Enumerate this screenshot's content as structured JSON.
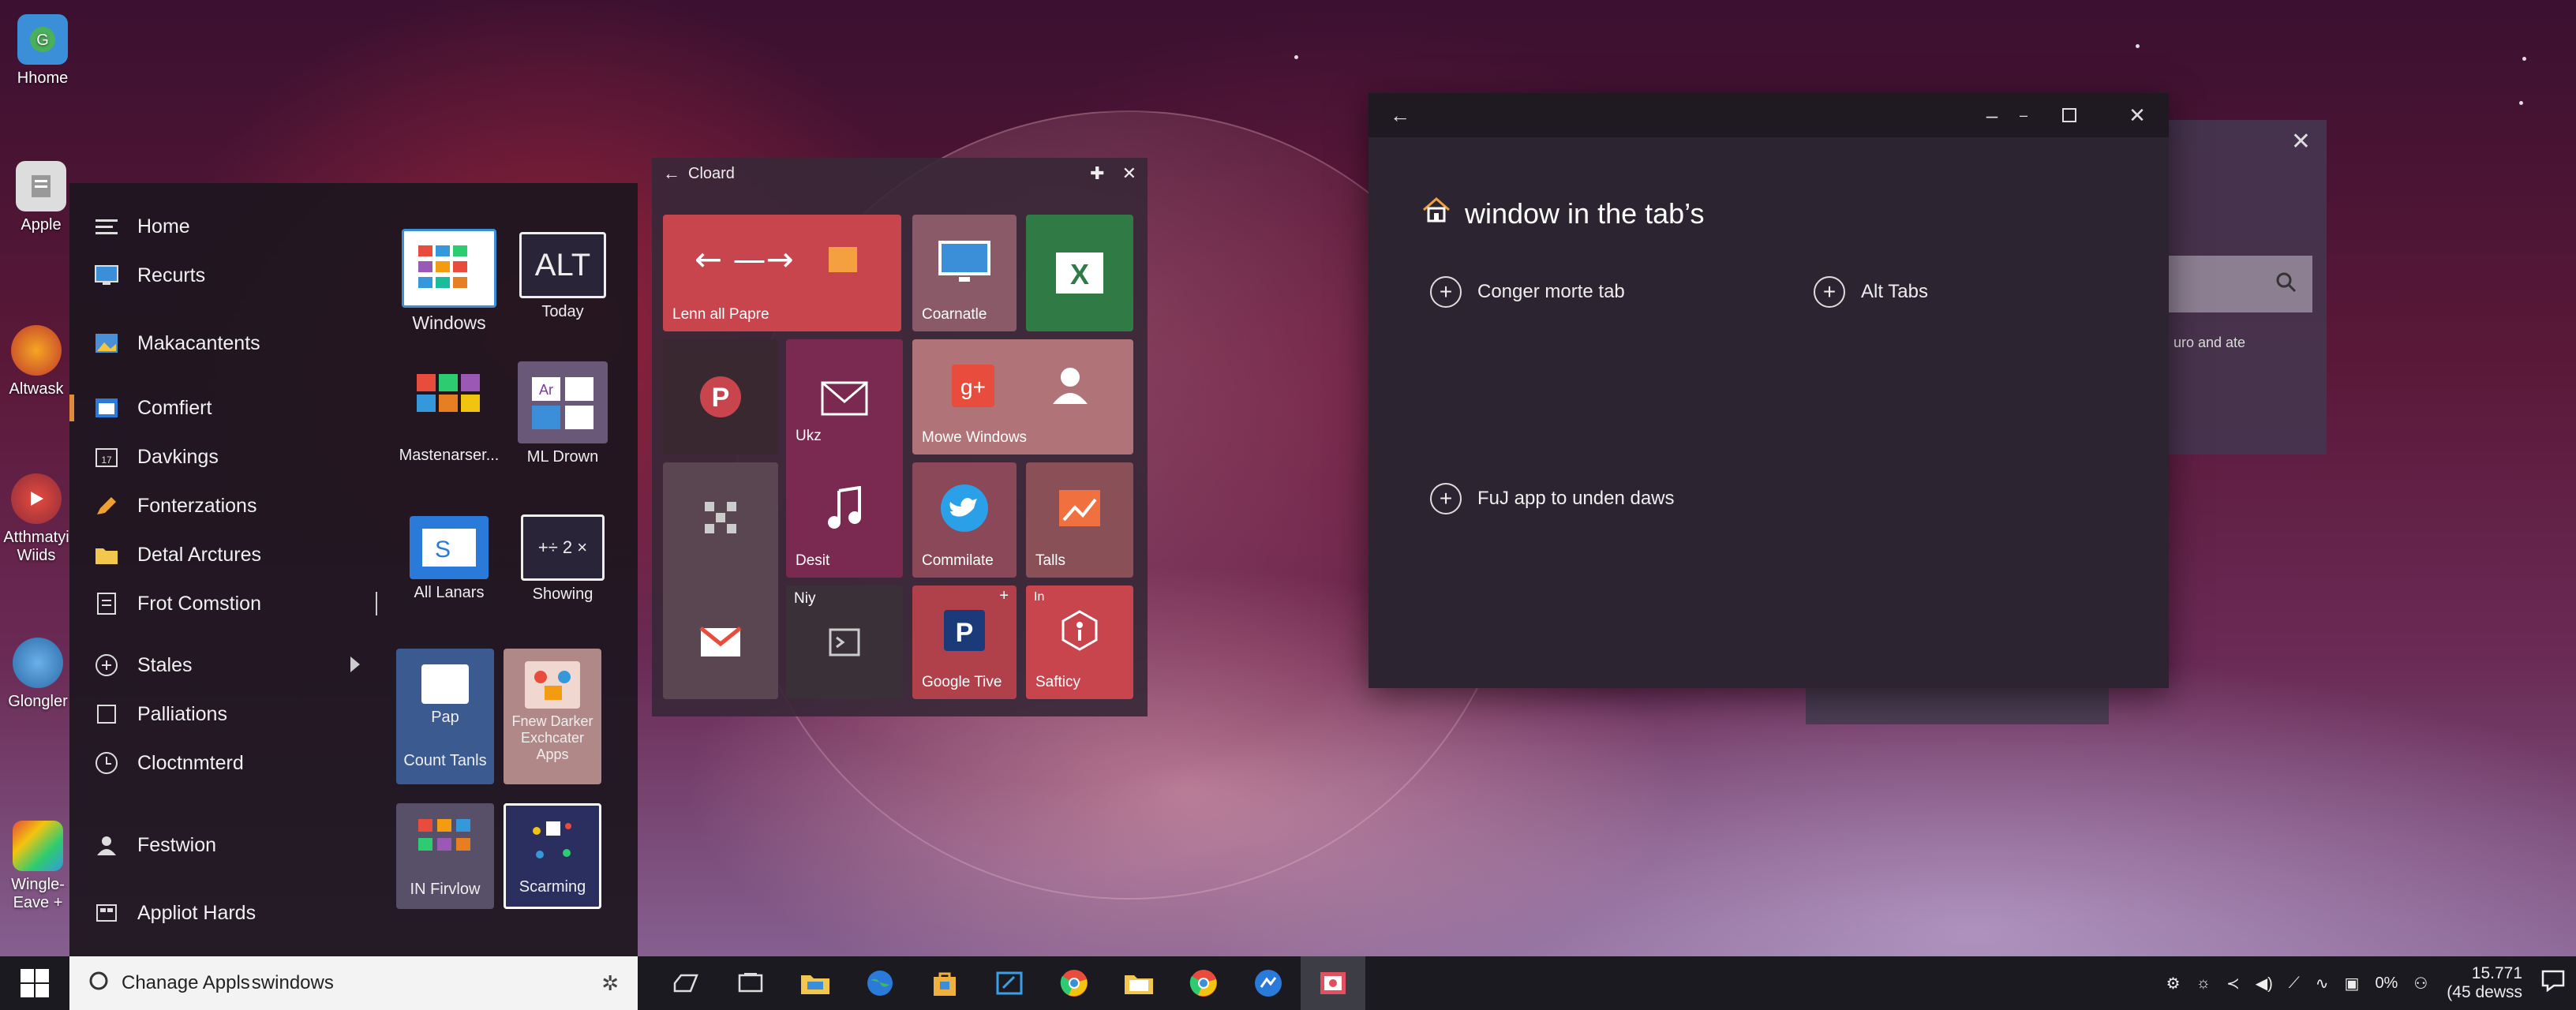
{
  "desktop": {
    "icons": [
      {
        "label": "Hhome",
        "icon": "home-app-icon"
      },
      {
        "label": "Apple",
        "icon": "apple-doc-icon"
      },
      {
        "label": "Altwask",
        "icon": "altwask-icon"
      },
      {
        "label": "Atthmatyi Wiids",
        "icon": "atthmatyi-icon"
      },
      {
        "label": "Glongler",
        "icon": "glongler-icon"
      },
      {
        "label": "Wingle-Eave +",
        "icon": "wingle-icon"
      }
    ]
  },
  "start_menu": {
    "nav": [
      {
        "label": "Home",
        "icon": "menu-lines-icon"
      },
      {
        "label": "Recurts",
        "icon": "monitor-icon"
      },
      {
        "label": "Makacantents",
        "icon": "photos-icon"
      },
      {
        "label": "Comfiert",
        "icon": "browser-icon"
      },
      {
        "label": "Davkings",
        "icon": "calendar-icon"
      },
      {
        "label": "Fonterzations",
        "icon": "pencil-icon"
      },
      {
        "label": "Detal Arctures",
        "icon": "folder-icon"
      },
      {
        "label": "Frot Comstion",
        "icon": "document-icon"
      },
      {
        "label": "Stales",
        "icon": "plus-circle-icon"
      },
      {
        "label": "Palliations",
        "icon": "square-icon"
      },
      {
        "label": "Cloctnmterd",
        "icon": "clock-icon"
      },
      {
        "label": "Festwion",
        "icon": "person-icon"
      },
      {
        "label": "Appliot Hards",
        "icon": "apps-icon"
      }
    ],
    "app_tiles": [
      {
        "label": "Windows"
      },
      {
        "label": "Today",
        "badge": "ALT"
      },
      {
        "label": "Mastenarser..."
      },
      {
        "label": "ML Drown"
      },
      {
        "label": "All Lanars"
      },
      {
        "label": "Showing"
      },
      {
        "label": "Count Tanls",
        "sub": "Pap"
      },
      {
        "label": "Fnew Darker Exchcater Apps"
      },
      {
        "label": "IN Firvlow"
      },
      {
        "label": "Scarming"
      }
    ]
  },
  "tiles_panel": {
    "title": "Cloard",
    "tiles": [
      {
        "label": "Lenn all Papre",
        "color": "#c8454e"
      },
      {
        "label": "Coarnatle",
        "color": "#8a5a68"
      },
      {
        "label": "",
        "color": "#2f7a45"
      },
      {
        "label": "",
        "color": "#3a2830"
      },
      {
        "label": "Ukz",
        "color": "#7a2a50"
      },
      {
        "label": "Mowe Windows",
        "color": "#b07478"
      },
      {
        "label": "",
        "color": "#5a4650"
      },
      {
        "label": "Desit",
        "color": "#7a2a50"
      },
      {
        "label": "Commilate",
        "color": "#8a4858"
      },
      {
        "label": "Talls",
        "color": "#8a5058"
      },
      {
        "label": "",
        "color": "#5a4650"
      },
      {
        "label": "",
        "sub": "Niy",
        "color": "#3a3038"
      },
      {
        "label": "Google Tive",
        "color": "#b0404a"
      },
      {
        "label": "Safticy",
        "sub": "In",
        "color": "#c8454e"
      }
    ]
  },
  "main_window": {
    "title": "window in the tab’s",
    "options": [
      {
        "label": "Conger morte tab"
      },
      {
        "label": "Alt Tabs"
      },
      {
        "label": "FuJ app to unden daws"
      }
    ]
  },
  "back_window": {
    "text": "uro and ate"
  },
  "taskbar": {
    "search_text": "Chanage Appls swindows",
    "tray": {
      "percent": "0%",
      "time": "15.771",
      "date": "(45 dewss"
    }
  }
}
